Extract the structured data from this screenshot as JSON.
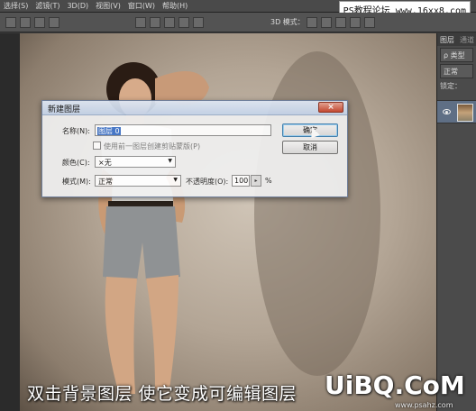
{
  "menubar": {
    "items": [
      "选择(S)",
      "滤镜(T)",
      "3D(D)",
      "视图(V)",
      "窗口(W)",
      "帮助(H)"
    ]
  },
  "watermark_top": "PS教程论坛 www.16xx8.com",
  "optionsbar": {
    "mode_label": "3D 模式："
  },
  "rightpanel": {
    "tabs": [
      "图层",
      "通道"
    ],
    "filter_label": "ρ 类型",
    "blend": "正常",
    "lock_label": "锁定："
  },
  "dialog": {
    "title": "新建图层",
    "close_label": "×",
    "name_label": "名称(N):",
    "name_value": "图层 0",
    "clip_label": "使用前一图层创建剪贴蒙版(P)",
    "color_label": "颜色(C):",
    "color_value": "×无",
    "mode_label": "模式(M):",
    "mode_value": "正常",
    "opacity_label": "不透明度(O):",
    "opacity_value": "100",
    "opacity_unit": "%",
    "ok_label": "确定",
    "cancel_label": "取消"
  },
  "caption": "双击背景图层   使它变成可编辑图层",
  "logo": "UiBQ.CoM",
  "logo_sub": "www.psahz.com"
}
